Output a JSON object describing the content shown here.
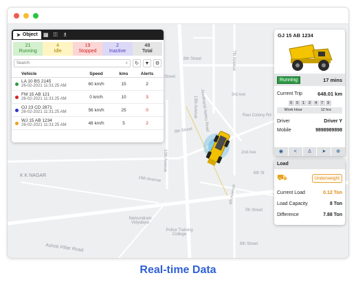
{
  "window": {
    "controls": [
      "close",
      "minimize",
      "maximize"
    ],
    "colors": {
      "close": "#ef5b52",
      "minimize": "#f6bd32",
      "maximize": "#2bc440"
    }
  },
  "map": {
    "labels": [
      "K K NAGAR",
      "Street",
      "3rd Ave",
      "8th Street",
      "10th Avenue",
      "Jawaharlal Nehru Road",
      "13th Avenue",
      "7th Avenue",
      "8th Street",
      "16th Avenue",
      "Ashok Pillar Road",
      "Nerkundram Vidyalaya",
      "Police Training College",
      "4th Avenue",
      "7th Street",
      "8th Street",
      "Ravi Colony Rd",
      "6th St",
      "2nd Ave"
    ],
    "accent": "#f4c400"
  },
  "object_panel": {
    "tabs": [
      {
        "label": "Object",
        "icon": "navigation-arrow-icon"
      },
      {
        "icon": "building-icon"
      },
      {
        "icon": "grid-icon"
      },
      {
        "icon": "user-tree-icon"
      }
    ],
    "status": [
      {
        "count": "21",
        "label": "Running",
        "bg": "#d4f0cf",
        "color": "#2e8b2e"
      },
      {
        "count": "4",
        "label": "Idle",
        "bg": "#fff5c2",
        "color": "#a87d00"
      },
      {
        "count": "19",
        "label": "Stopped",
        "bg": "#fbd6d6",
        "color": "#d12424"
      },
      {
        "count": "2",
        "label": "Inactive",
        "bg": "#dcd9f7",
        "color": "#4b3fbf"
      },
      {
        "count": "48",
        "label": "Total",
        "bg": "#e6e6e6",
        "color": "#111111"
      }
    ],
    "search_placeholder": "Search",
    "columns": [
      "Vehicle",
      "Speed",
      "kms",
      "Alerts"
    ],
    "rows": [
      {
        "vehicle": "LA 10 BS 2145",
        "time": "26-02-2021 11:31:25 AM",
        "speed": "60 km/h",
        "kms": "15",
        "alerts": "2",
        "dot": "#2e9a46",
        "alert_color": "#222222"
      },
      {
        "vehicle": "FM 15 AB 121",
        "time": "26-02-2021 11:31:25 AM",
        "speed": "0 km/h",
        "kms": "10",
        "alerts": "3",
        "dot": "#d12424",
        "alert_color": "#d12424"
      },
      {
        "vehicle": "OJ 23 CD 2871",
        "time": "26-02-2021 11:31:25 AM",
        "speed": "56 km/h",
        "kms": "25",
        "alerts": "0",
        "dot": "#2b34c9",
        "alert_color": "#d12424"
      },
      {
        "vehicle": "WJ 15 AB 1234",
        "time": "26-02-2021 11:31:25 AM",
        "speed": "48 km/h",
        "kms": "5",
        "alerts": "2",
        "dot": "#e8a21b",
        "alert_color": "#d12424"
      }
    ]
  },
  "detail_panel": {
    "title": "GJ 15 AB 1234",
    "status": "Running",
    "duration": "17 mins",
    "current_trip_label": "Current Trip",
    "current_trip_value": "648.01 km",
    "odometer_digits": [
      "0",
      "0",
      "1",
      "2",
      "4",
      "7",
      "9"
    ],
    "work_hour_label": "Work Hour",
    "work_hour_value": "12 hrs",
    "driver_label": "Driver",
    "driver_value": "Driver Y",
    "mobile_label": "Mobile",
    "mobile_value": "9898989898",
    "actions": [
      "eye-icon",
      "share-icon",
      "user-icon",
      "navigate-icon",
      "zoom-icon"
    ]
  },
  "load_panel": {
    "title": "Load",
    "badge": "Underweight",
    "current_load_label": "Current Load",
    "current_load_value": "0.12 Ton",
    "capacity_label": "Load Capacity",
    "capacity_value": "8 Ton",
    "difference_label": "Difference",
    "difference_value": "7.88 Ton"
  },
  "caption": "Real-time Data"
}
